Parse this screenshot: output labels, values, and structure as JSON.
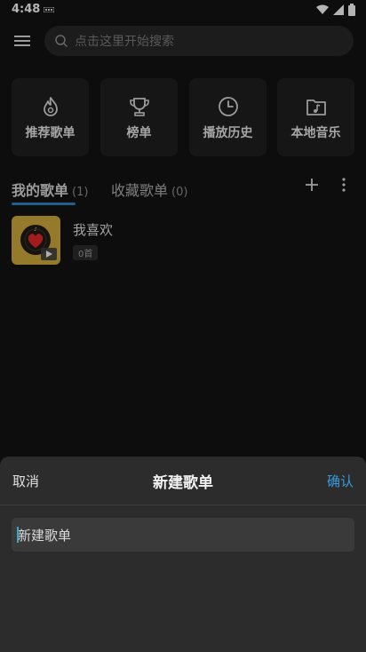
{
  "status_bar": {
    "time": "4:48"
  },
  "search": {
    "placeholder": "点击这里开始搜索"
  },
  "quick_cards": [
    {
      "label": "推荐歌单",
      "icon": "flame-icon"
    },
    {
      "label": "榜单",
      "icon": "trophy-icon"
    },
    {
      "label": "播放历史",
      "icon": "clock-icon"
    },
    {
      "label": "本地音乐",
      "icon": "music-folder-icon"
    }
  ],
  "tabs": {
    "mine": {
      "label": "我的歌单",
      "count": "(1)"
    },
    "favorites": {
      "label": "收藏歌单",
      "count": "(0)"
    }
  },
  "playlists": [
    {
      "title": "我喜欢",
      "count": "0首"
    }
  ],
  "sheet": {
    "cancel": "取消",
    "title": "新建歌单",
    "confirm": "确认",
    "input_value": "新建歌单"
  },
  "colors": {
    "accent": "#2a7fb8",
    "confirm": "#3a9ad9",
    "background": "#121212",
    "sheet": "#2c2c2c"
  }
}
